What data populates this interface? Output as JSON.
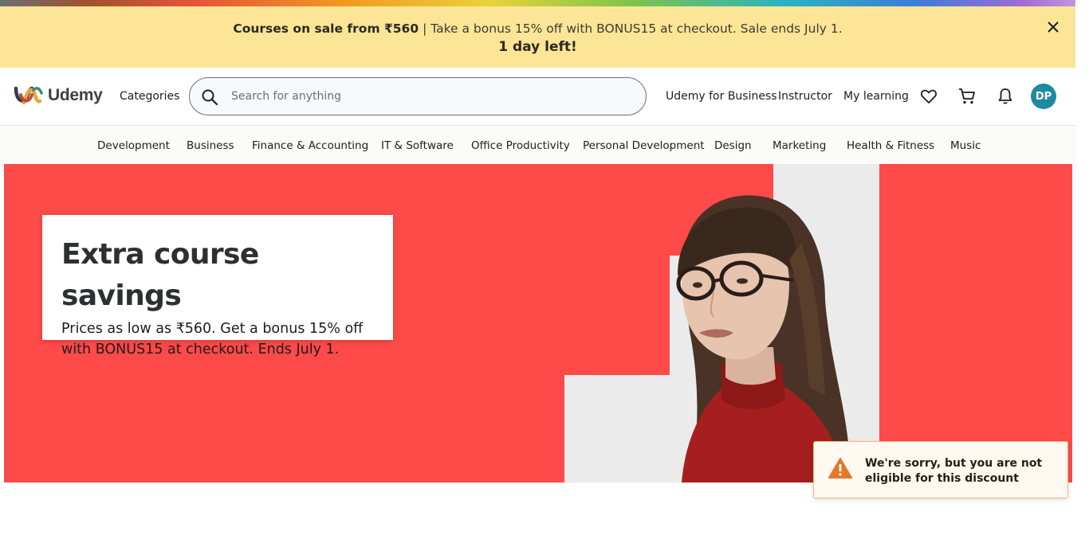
{
  "promo": {
    "bold_text": "Courses on sale from ₹560",
    "rest_text": " | Take a bonus 15% off with BONUS15 at checkout. Sale ends July 1.",
    "countdown": "1 day left!"
  },
  "header": {
    "logo_text": "Udemy",
    "categories_label": "Categories",
    "search_placeholder": "Search for anything",
    "business_link": "Udemy for Business",
    "instructor_link": "Instructor",
    "my_learning_link": "My learning",
    "avatar_initials": "DP"
  },
  "categories": [
    "Development",
    "Business",
    "Finance & Accounting",
    "IT & Software",
    "Office Productivity",
    "Personal Development",
    "Design",
    "Marketing",
    "Health & Fitness",
    "Music"
  ],
  "hero": {
    "title": "Extra course savings",
    "subtitle": "Prices as low as ₹560. Get a bonus 15% off with BONUS15 at checkout. Ends July 1."
  },
  "toast": {
    "message": "We're sorry, but you are not eligible for this discount"
  },
  "colors": {
    "promo_bg": "#fde597",
    "hero_bg": "#fe4a49",
    "avatar_bg": "#1e8aa1",
    "toast_border": "#f3b27a",
    "warning_icon": "#e07a2b"
  }
}
